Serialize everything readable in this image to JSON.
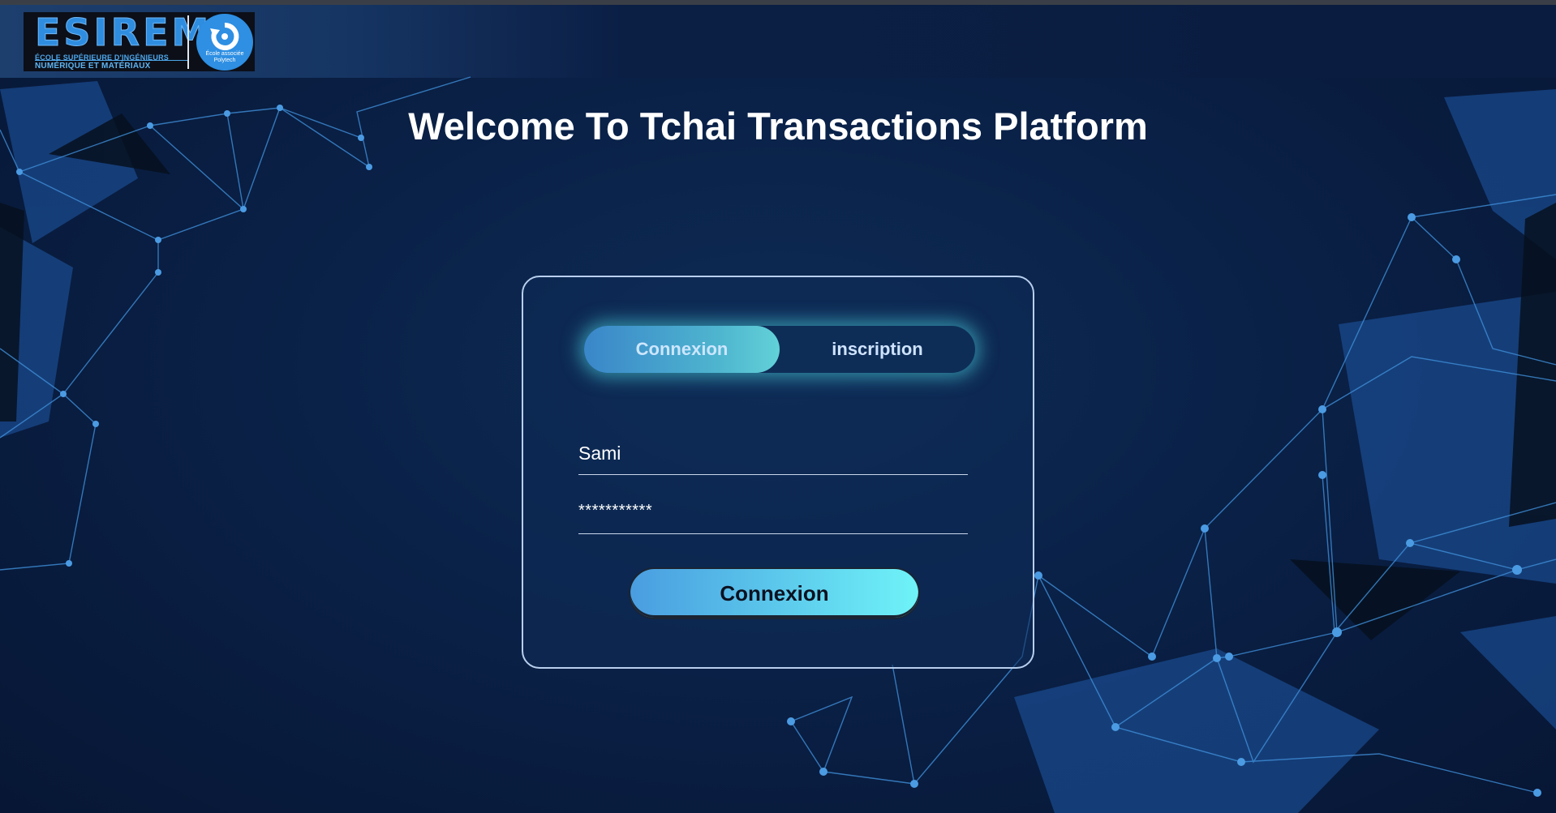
{
  "header": {
    "logo": {
      "wordmark": "ESIREM",
      "tagline_1": "ÉCOLE SUPÉRIEURE D'INGÉNIEURS",
      "tagline_2": "NUMÉRIQUE ET MATÉRIAUX",
      "badge_text": "École associée Polytech"
    }
  },
  "page": {
    "title": "Welcome To Tchai Transactions Platform"
  },
  "auth": {
    "tabs": [
      {
        "label": "Connexion",
        "active": true
      },
      {
        "label": "inscription",
        "active": false
      }
    ],
    "username_value": "Sami",
    "password_value": "***********",
    "submit_label": "Connexion"
  },
  "colors": {
    "background": "#0a2147",
    "accent_cyan": "#6ff3f8",
    "accent_blue": "#4a9de0",
    "card_border": "#b9cfee"
  }
}
